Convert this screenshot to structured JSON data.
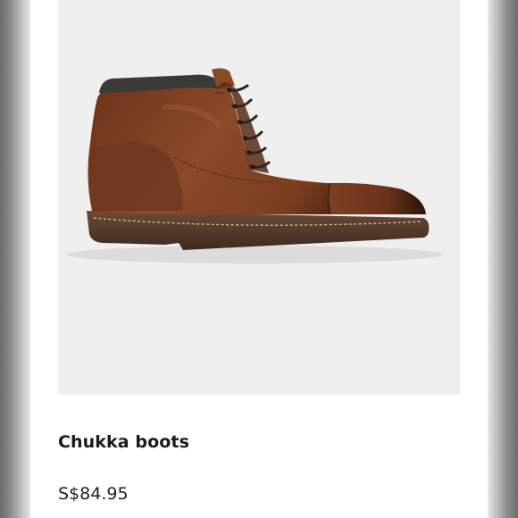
{
  "product": {
    "name": "Chukka boots",
    "price": "S$84.95",
    "image_subject": "brown leather chukka boot",
    "image_background": "#efefef"
  },
  "colors": {
    "leather": "#7a3e22",
    "leather_dark": "#4a2414",
    "sole": "#5b3f2e",
    "collar": "#3b3a38",
    "text": "#1a1a1a"
  }
}
